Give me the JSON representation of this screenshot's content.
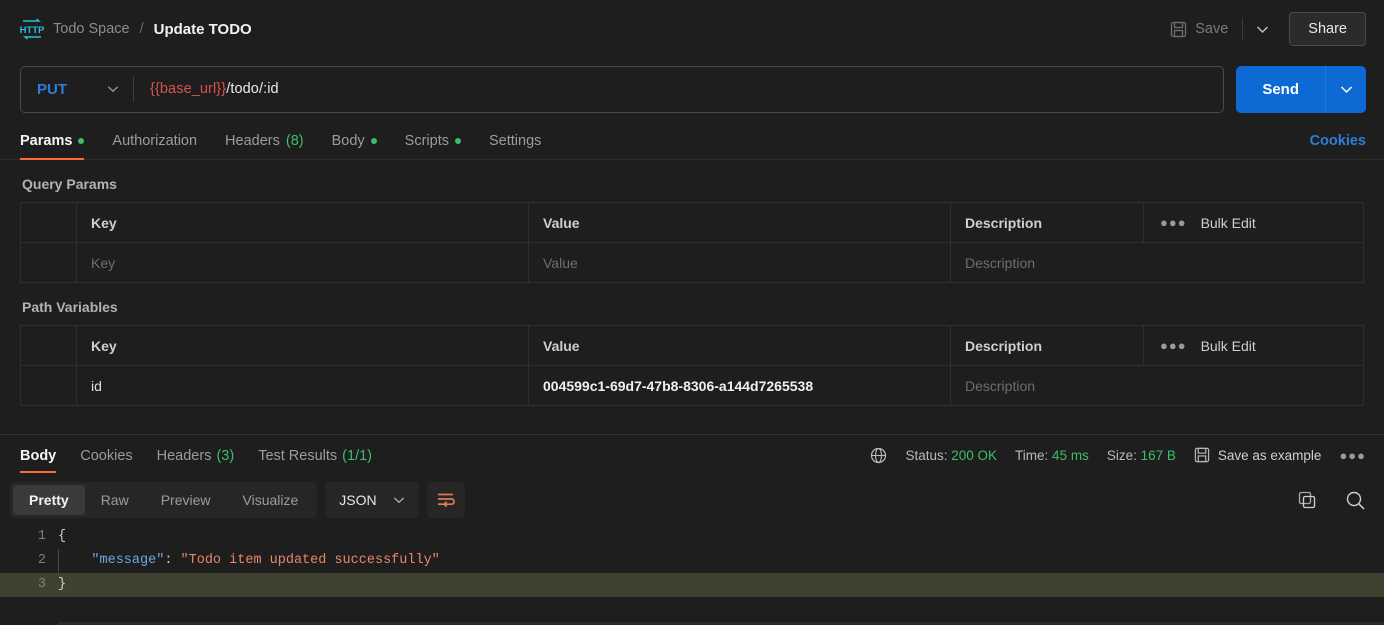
{
  "header": {
    "icon": "http-protocol-icon",
    "breadcrumb_space": "Todo Space",
    "breadcrumb_separator": "/",
    "breadcrumb_title": "Update TODO",
    "save_label": "Save",
    "save_icon": "floppy-disk-icon",
    "save_caret_icon": "chevron-down-icon",
    "share_label": "Share"
  },
  "url_bar": {
    "method": "PUT",
    "method_caret_icon": "chevron-down-icon",
    "url_variable": "{{base_url}}",
    "url_path": "/todo/:id",
    "send_label": "Send",
    "send_caret_icon": "chevron-down-icon"
  },
  "request_tabs": {
    "items": [
      {
        "label": "Params",
        "active": true,
        "dot": true,
        "count": ""
      },
      {
        "label": "Authorization",
        "active": false,
        "dot": false,
        "count": ""
      },
      {
        "label": "Headers",
        "active": false,
        "dot": false,
        "count": "(8)"
      },
      {
        "label": "Body",
        "active": false,
        "dot": true,
        "count": ""
      },
      {
        "label": "Scripts",
        "active": false,
        "dot": true,
        "count": ""
      },
      {
        "label": "Settings",
        "active": false,
        "dot": false,
        "count": ""
      }
    ],
    "cookies_link": "Cookies"
  },
  "query_params": {
    "title": "Query Params",
    "columns": [
      "Key",
      "Value",
      "Description"
    ],
    "bulk_edit_label": "Bulk Edit",
    "bulk_edit_icon": "ellipsis-icon",
    "rows": [
      {
        "key_placeholder": "Key",
        "value_placeholder": "Value",
        "description_placeholder": "Description"
      }
    ]
  },
  "path_variables": {
    "title": "Path Variables",
    "columns": [
      "Key",
      "Value",
      "Description"
    ],
    "bulk_edit_label": "Bulk Edit",
    "bulk_edit_icon": "ellipsis-icon",
    "rows": [
      {
        "key": "id",
        "value": "004599c1-69d7-47b8-8306-a144d7265538",
        "description_placeholder": "Description"
      }
    ]
  },
  "response": {
    "tabs": [
      {
        "label": "Body",
        "active": true,
        "count": ""
      },
      {
        "label": "Cookies",
        "active": false,
        "count": ""
      },
      {
        "label": "Headers",
        "active": false,
        "count": "(3)"
      },
      {
        "label": "Test Results",
        "active": false,
        "count": "(1/1)"
      }
    ],
    "network_icon": "globe-icon",
    "status_label": "Status:",
    "status_value": "200 OK",
    "time_label": "Time:",
    "time_value": "45 ms",
    "size_label": "Size:",
    "size_value": "167 B",
    "save_example_label": "Save as example",
    "save_example_icon": "floppy-disk-icon",
    "more_icon": "ellipsis-icon"
  },
  "format_bar": {
    "views": [
      {
        "label": "Pretty",
        "active": true
      },
      {
        "label": "Raw",
        "active": false
      },
      {
        "label": "Preview",
        "active": false
      },
      {
        "label": "Visualize",
        "active": false
      }
    ],
    "language": "JSON",
    "language_caret_icon": "chevron-down-icon",
    "wrap_icon": "wrap-text-icon",
    "copy_icon": "copy-icon",
    "search_icon": "search-icon"
  },
  "code": {
    "lines": [
      {
        "number": "1",
        "open_brace": "{",
        "highlighted": false
      },
      {
        "number": "2",
        "key": "\"message\"",
        "colon": ": ",
        "value": "\"Todo item updated successfully\"",
        "highlighted": false
      },
      {
        "number": "3",
        "close_brace": "}",
        "highlighted": true
      }
    ]
  },
  "colors": {
    "accent_orange": "#ff6c37",
    "send_blue": "#0d6ad4",
    "method_blue": "#2f7ddb",
    "success_green": "#3dbd69",
    "variable_red": "#d9534f",
    "background": "#1e1e1e",
    "highlight_line": "#41412f"
  }
}
